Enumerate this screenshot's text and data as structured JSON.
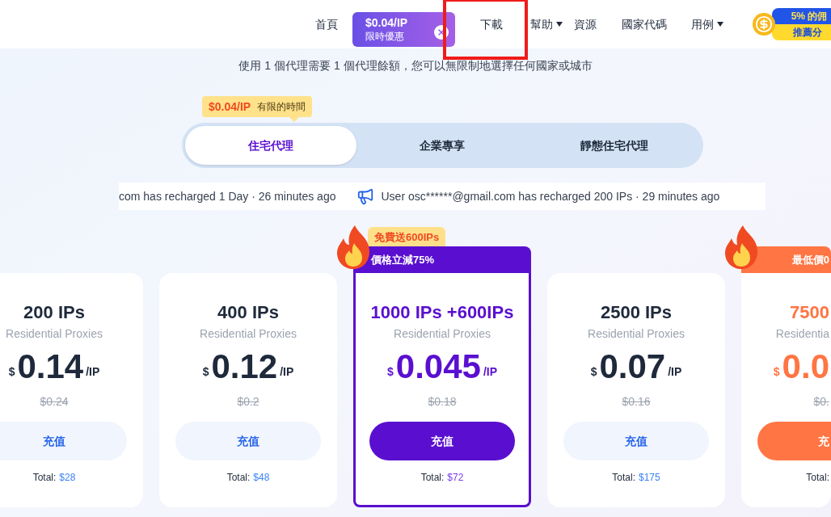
{
  "nav": {
    "items": [
      {
        "label": "首頁",
        "kind": "link",
        "highlighted": false,
        "caret": false
      },
      {
        "kind": "promo",
        "price": "$0.04/IP",
        "label": "限時優惠"
      },
      {
        "label": "下載",
        "kind": "link",
        "highlighted": true,
        "caret": false
      },
      {
        "label": "幫助",
        "kind": "link",
        "highlighted": false,
        "caret": true
      },
      {
        "label": "資源",
        "kind": "link",
        "highlighted": false,
        "caret": false
      },
      {
        "label": "國家代碼",
        "kind": "link",
        "highlighted": false,
        "caret": false
      },
      {
        "label": "用例",
        "kind": "link",
        "highlighted": false,
        "caret": true
      }
    ],
    "referral": {
      "top": "5% 的佣",
      "bottom": "推薦分"
    }
  },
  "subtitle": "使用 1 個代理需要 1 個代理餘額，您可以無限制地選擇任何國家或城市",
  "offer_tooltip": {
    "price": "$0.04/IP",
    "label": "有限的時間"
  },
  "tabs": [
    {
      "label": "住宅代理",
      "selected": true
    },
    {
      "label": "企業專享",
      "selected": false
    },
    {
      "label": "靜態住宅代理",
      "selected": false
    }
  ],
  "ticker": [
    {
      "text": "com has recharged 1 Day · 26 minutes ago",
      "icon": false
    },
    {
      "text": "User osc******@gmail.com has recharged 200 IPs · 29 minutes ago",
      "icon": true
    }
  ],
  "plans": [
    {
      "kind": "none",
      "title": "200 IPs",
      "subtitle": "Residential Proxies",
      "currency": "$",
      "price": "0.14",
      "unit": "/IP",
      "old_price": "$0.24",
      "button": "充值",
      "total_label": "Total:",
      "total": "$28"
    },
    {
      "kind": "none",
      "title": "400 IPs",
      "subtitle": "Residential Proxies",
      "currency": "$",
      "price": "0.12",
      "unit": "/IP",
      "old_price": "$0.2",
      "button": "充值",
      "total_label": "Total:",
      "total": "$48"
    },
    {
      "kind": "purple",
      "tag": "免費送600IPs",
      "banner": "價格立減75%",
      "title": "1000 IPs +600IPs",
      "subtitle": "Residential Proxies",
      "currency": "$",
      "price": "0.045",
      "unit": "/IP",
      "old_price": "$0.18",
      "button": "充值",
      "total_label": "Total:",
      "total": "$72"
    },
    {
      "kind": "none",
      "title": "2500 IPs",
      "subtitle": "Residential Proxies",
      "currency": "$",
      "price": "0.07",
      "unit": "/IP",
      "old_price": "$0.16",
      "button": "充值",
      "total_label": "Total:",
      "total": "$175"
    },
    {
      "kind": "orange",
      "banner": "最低價0",
      "title": "7500",
      "subtitle": "Residentia",
      "currency": "$",
      "price": "0.0",
      "old_price": "$0.",
      "button": "充",
      "total_label": "Total:"
    }
  ]
}
